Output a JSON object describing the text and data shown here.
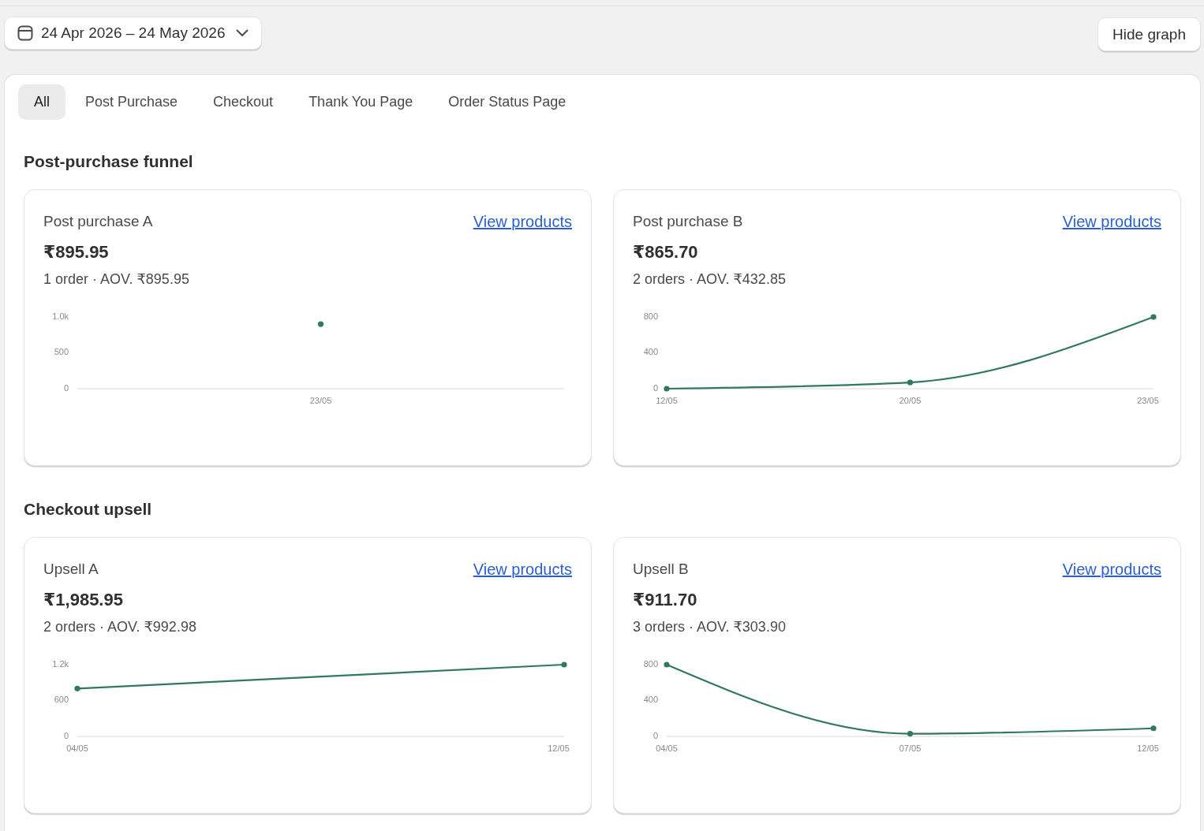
{
  "date_picker": {
    "label": "24 Apr 2026 – 24 May 2026"
  },
  "hide_graph_button": {
    "label": "Hide graph"
  },
  "tabs": [
    {
      "label": "All",
      "selected": true
    },
    {
      "label": "Post Purchase",
      "selected": false
    },
    {
      "label": "Checkout",
      "selected": false
    },
    {
      "label": "Thank You Page",
      "selected": false
    },
    {
      "label": "Order Status Page",
      "selected": false
    }
  ],
  "sections": [
    {
      "title": "Post-purchase funnel",
      "cards": [
        {
          "title": "Post purchase A",
          "link": "View products",
          "amount": "₹895.95",
          "summary": "1 order · AOV. ₹895.95",
          "chart_data": {
            "type": "line",
            "categories": [
              "23/05"
            ],
            "series": [
              {
                "color": "#2e7a5a",
                "marker": "circle",
                "values": [
                  900
                ]
              }
            ],
            "ylim": [
              0,
              1000
            ],
            "yticks": [
              0,
              500,
              {
                "value": 1000,
                "label": "1.0k"
              }
            ]
          }
        },
        {
          "title": "Post purchase B",
          "link": "View products",
          "amount": "₹865.70",
          "summary": "2 orders · AOV. ₹432.85",
          "chart_data": {
            "type": "line",
            "categories": [
              "12/05",
              "20/05",
              "23/05"
            ],
            "series": [
              {
                "color": "#2e7a5a",
                "marker": "circle",
                "values": [
                  0,
                  70,
                  800
                ]
              }
            ],
            "ylim": [
              0,
              800
            ],
            "yticks": [
              0,
              400,
              800
            ]
          }
        }
      ]
    },
    {
      "title": "Checkout upsell",
      "cards": [
        {
          "title": "Upsell A",
          "link": "View products",
          "amount": "₹1,985.95",
          "summary": "2 orders · AOV. ₹992.98",
          "chart_data": {
            "type": "line",
            "categories": [
              "04/05",
              "12/05"
            ],
            "series": [
              {
                "color": "#2e7a5a",
                "marker": "circle",
                "values": [
                  800,
                  1200
                ]
              }
            ],
            "ylim": [
              0,
              1200
            ],
            "yticks": [
              0,
              600,
              {
                "value": 1200,
                "label": "1.2k"
              }
            ]
          }
        },
        {
          "title": "Upsell B",
          "link": "View products",
          "amount": "₹911.70",
          "summary": "3 orders · AOV. ₹303.90",
          "chart_data": {
            "type": "line",
            "categories": [
              "04/05",
              "07/05",
              "12/05"
            ],
            "series": [
              {
                "color": "#2e7a5a",
                "marker": "circle",
                "values": [
                  800,
                  30,
                  90
                ]
              }
            ],
            "ylim": [
              0,
              800
            ],
            "yticks": [
              0,
              400,
              800
            ]
          }
        }
      ]
    }
  ]
}
